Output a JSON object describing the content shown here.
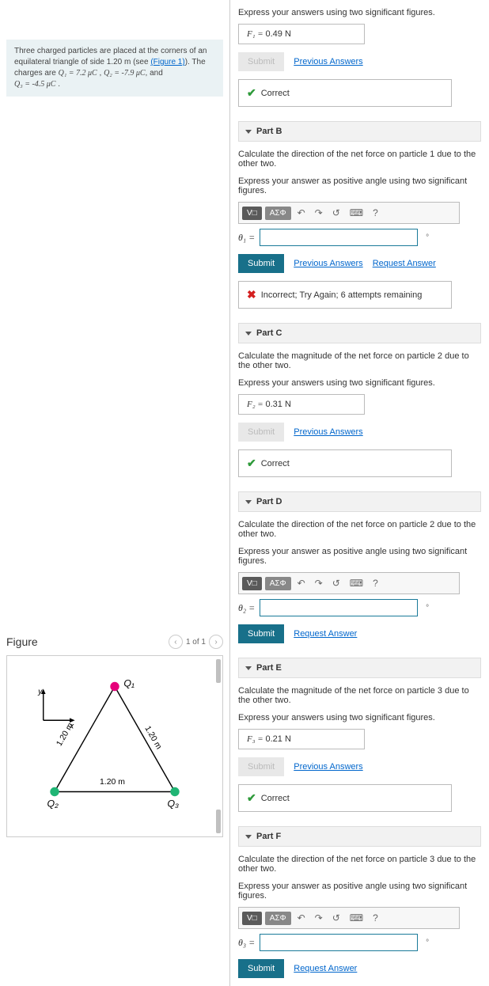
{
  "problem": {
    "text_pre": "Three charged particles are placed at the corners of an equilateral triangle of side 1.20 m (see ",
    "fig_link": "(Figure 1)",
    "text_post": "). The charges are ",
    "q1": "Q₁ = 7.2 μC",
    "q2": "Q₂ = -7.9 μC",
    "q3": "Q₃ = -4.5 μC",
    "comma": " , ",
    "and": ", and ",
    "period": " ."
  },
  "figure": {
    "title": "Figure",
    "counter": "1 of 1",
    "labels": {
      "q1": "Q₁",
      "q2": "Q₂",
      "q3": "Q₃",
      "side": "1.20 m",
      "y": "y",
      "x": "x"
    }
  },
  "partA": {
    "instr": "Express your answers using two significant figures.",
    "answer_lhs": "F₁ = ",
    "answer_val": "0.49",
    "answer_unit": " N",
    "submit": "Submit",
    "prev": "Previous Answers",
    "fb": "Correct"
  },
  "partB": {
    "title": "Part B",
    "prompt": "Calculate the direction of the net force on particle 1 due to the other two.",
    "instr": "Express your answer as positive angle using two significant figures.",
    "lbl": "θ₁ = ",
    "submit": "Submit",
    "prev": "Previous Answers",
    "req": "Request Answer",
    "fb": "Incorrect; Try Again; 6 attempts remaining"
  },
  "partC": {
    "title": "Part C",
    "prompt": "Calculate the magnitude of the net force on particle 2 due to the other two.",
    "instr": "Express your answers using two significant figures.",
    "answer_lhs": "F₂ = ",
    "answer_val": "0.31",
    "answer_unit": " N",
    "submit": "Submit",
    "prev": "Previous Answers",
    "fb": "Correct"
  },
  "partD": {
    "title": "Part D",
    "prompt": "Calculate the direction of the net force on particle 2 due to the other two.",
    "instr": "Express your answer as positive angle using two significant figures.",
    "lbl": "θ₂ = ",
    "submit": "Submit",
    "req": "Request Answer"
  },
  "partE": {
    "title": "Part E",
    "prompt": "Calculate the magnitude of the net force on particle 3 due to the other two.",
    "instr": "Express your answers using two significant figures.",
    "answer_lhs": "F₃ = ",
    "answer_val": "0.21",
    "answer_unit": " N",
    "submit": "Submit",
    "prev": "Previous Answers",
    "fb": "Correct"
  },
  "partF": {
    "title": "Part F",
    "prompt": "Calculate the direction of the net force on particle 3 due to the other two.",
    "instr": "Express your answer as positive angle using two significant figures.",
    "lbl": "θ₃ = ",
    "submit": "Submit",
    "req": "Request Answer"
  },
  "toolbar": {
    "vec": "V□",
    "greek": "ΑΣΦ",
    "undo": "↶",
    "redo": "↷",
    "reset": "↺",
    "kb": "⌨",
    "help": "?"
  }
}
